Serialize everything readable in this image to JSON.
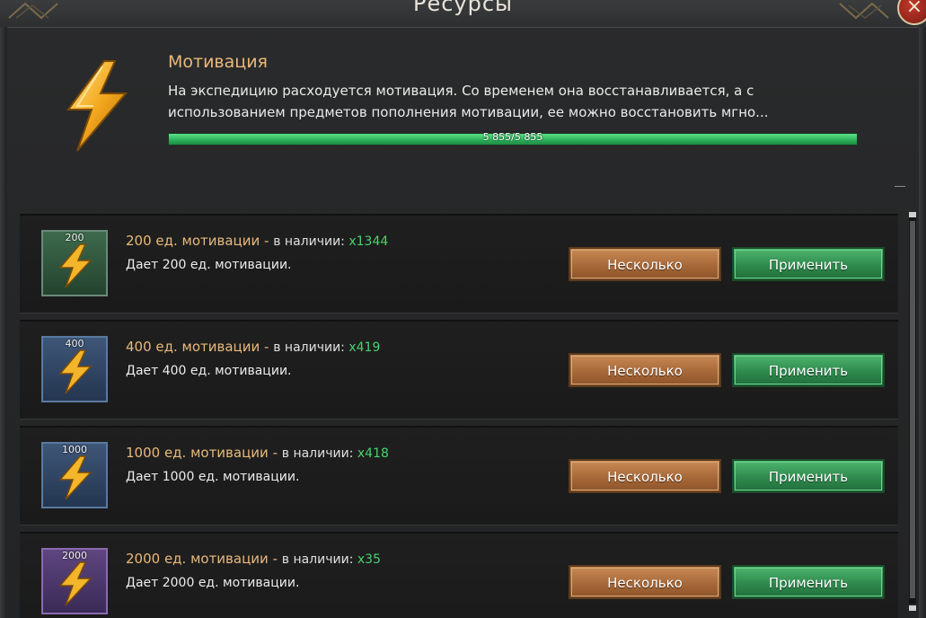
{
  "window": {
    "title": "Ресурсы",
    "close_label": "×"
  },
  "resource": {
    "name": "Мотивация",
    "description": "На экспедицию расходуется мотивация. Со временем она восстанавливается, а с\nиспользованием предметов пополнения мотивации, ее можно восстановить мгно...",
    "progress_text": "5 855/5 855",
    "progress_fraction": 1.0
  },
  "items": [
    {
      "badge": "200",
      "name": "200 ед. мотивации",
      "separator": " - ",
      "availability_label": "в наличии: ",
      "count": "x1344",
      "description": "Дает 200 ед. мотивации.",
      "btn_multi": "Несколько",
      "btn_apply": "Применить",
      "frame_color": "#2e5a3e"
    },
    {
      "badge": "400",
      "name": "400 ед. мотивации",
      "separator": " - ",
      "availability_label": "в наличии: ",
      "count": "x419",
      "description": "Дает 400 ед. мотивации.",
      "btn_multi": "Несколько",
      "btn_apply": "Применить",
      "frame_color": "#2e4a6a"
    },
    {
      "badge": "1000",
      "name": "1000 ед. мотивации",
      "separator": " - ",
      "availability_label": "в наличии: ",
      "count": "x418",
      "description": "Дает 1000 ед. мотивации.",
      "btn_multi": "Несколько",
      "btn_apply": "Применить",
      "frame_color": "#2e4a6a"
    },
    {
      "badge": "2000",
      "name": "2000 ед. мотивации",
      "separator": " - ",
      "availability_label": "в наличии: ",
      "count": "x35",
      "description": "Дает 2000 ед. мотивации.",
      "btn_multi": "Несколько",
      "btn_apply": "Применить",
      "frame_color": "#4a2e6a"
    }
  ],
  "colors": {
    "accent_gold": "#eab97a",
    "count_green": "#46d36e",
    "progress_green": "#2cae59"
  },
  "icons": {
    "header": "lightning-icon",
    "item": "lightning-icon",
    "close": "close-icon"
  }
}
